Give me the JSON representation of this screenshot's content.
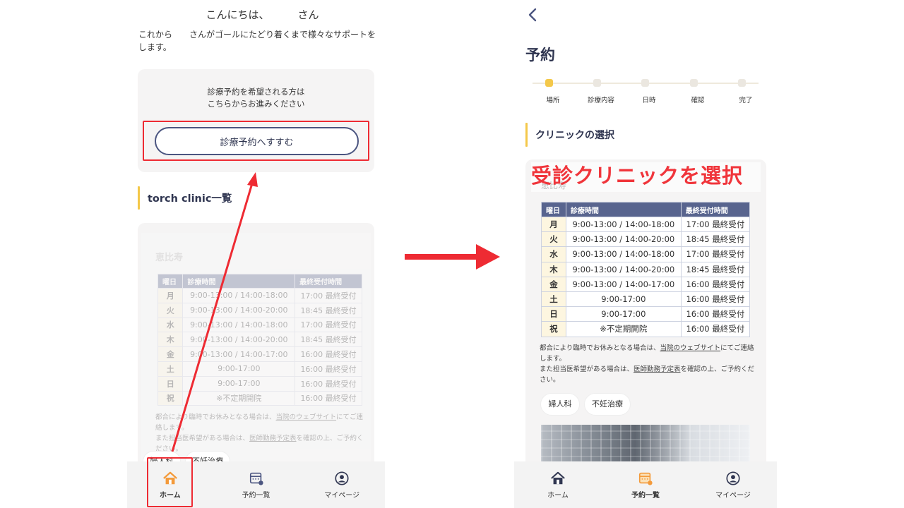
{
  "left": {
    "greeting": "こんにちは、",
    "greeting_suffix": "さん",
    "intro": "これから　　さんがゴールにたどり着くまで様々なサポートをします。",
    "reserve_card": {
      "line1": "診療予約を希望される方は",
      "line2": "こちらからお進みください",
      "button": "診療予約へすすむ"
    },
    "section_title": "torch clinic一覧",
    "clinic": {
      "name": "恵比寿",
      "headers": [
        "曜日",
        "診療時間",
        "最終受付時間"
      ],
      "rows": [
        [
          "月",
          "9:00-13:00 / 14:00-18:00",
          "17:00 最終受付"
        ],
        [
          "火",
          "9:00-13:00 / 14:00-20:00",
          "18:45 最終受付"
        ],
        [
          "水",
          "9:00-13:00 / 14:00-18:00",
          "17:00 最終受付"
        ],
        [
          "木",
          "9:00-13:00 / 14:00-20:00",
          "18:45 最終受付"
        ],
        [
          "金",
          "9:00-13:00 / 14:00-17:00",
          "16:00 最終受付"
        ],
        [
          "土",
          "9:00-17:00",
          "16:00 最終受付"
        ],
        [
          "日",
          "9:00-17:00",
          "16:00 最終受付"
        ],
        [
          "祝",
          "※不定期開院",
          "16:00 最終受付"
        ]
      ],
      "note1_pre": "都合により臨時でお休みとなる場合は、",
      "note1_link": "当院のウェブサイト",
      "note1_post": "にてご連絡します。",
      "note2_pre": "また担当医希望がある場合は、",
      "note2_link": "医師勤務予定表",
      "note2_post": "を確認の上、ご予約ください。",
      "tags": [
        "婦人科",
        "不妊治療"
      ]
    },
    "tabs": [
      "ホーム",
      "予約一覧",
      "マイページ"
    ]
  },
  "right": {
    "title": "予約",
    "steps": [
      "場所",
      "診療内容",
      "日時",
      "確認",
      "完了"
    ],
    "section_title": "クリニックの選択",
    "overlay": "受診クリニックを選択",
    "clinic": {
      "name": "恵比寿",
      "headers": [
        "曜日",
        "診療時間",
        "最終受付時間"
      ],
      "rows": [
        [
          "月",
          "9:00-13:00 / 14:00-18:00",
          "17:00 最終受付"
        ],
        [
          "火",
          "9:00-13:00 / 14:00-20:00",
          "18:45 最終受付"
        ],
        [
          "水",
          "9:00-13:00 / 14:00-18:00",
          "17:00 最終受付"
        ],
        [
          "木",
          "9:00-13:00 / 14:00-20:00",
          "18:45 最終受付"
        ],
        [
          "金",
          "9:00-13:00 / 14:00-17:00",
          "16:00 最終受付"
        ],
        [
          "土",
          "9:00-17:00",
          "16:00 最終受付"
        ],
        [
          "日",
          "9:00-17:00",
          "16:00 最終受付"
        ],
        [
          "祝",
          "※不定期開院",
          "16:00 最終受付"
        ]
      ],
      "note1_pre": "都合により臨時でお休みとなる場合は、",
      "note1_link": "当院のウェブサイト",
      "note1_post": "にてご連絡します。",
      "note2_pre": "また担当医希望がある場合は、",
      "note2_link": "医師勤務予定表",
      "note2_post": "を確認の上、ご予約ください。",
      "tags": [
        "婦人科",
        "不妊治療"
      ]
    },
    "tabs": [
      "ホーム",
      "予約一覧",
      "マイページ"
    ]
  },
  "colors": {
    "accent_yellow": "#f4c84a",
    "navy": "#2f3550",
    "table_header": "#58648e",
    "annotation_red": "#ee2b33",
    "home_orange": "#f39a3a"
  },
  "icons": {
    "home": "home-icon",
    "reservations": "calendar-icon",
    "mypage": "user-circle-icon",
    "back": "chevron-left-icon"
  }
}
